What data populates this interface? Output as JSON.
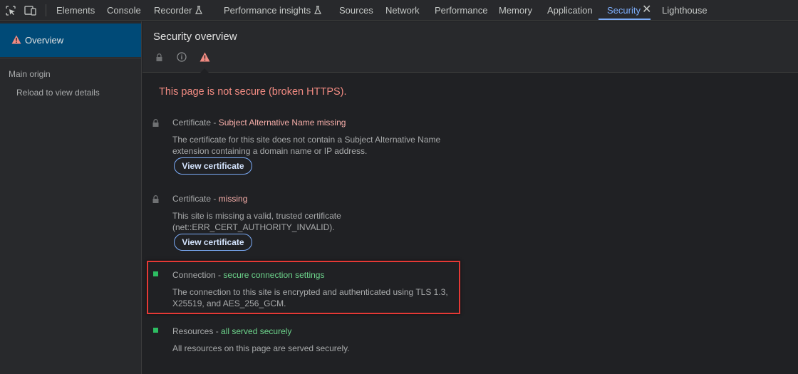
{
  "toolbar": {
    "tabs": [
      {
        "label": "Elements"
      },
      {
        "label": "Console"
      },
      {
        "label": "Recorder"
      },
      {
        "label": "Performance insights"
      },
      {
        "label": "Sources"
      },
      {
        "label": "Network"
      },
      {
        "label": "Performance"
      },
      {
        "label": "Memory"
      },
      {
        "label": "Application"
      },
      {
        "label": "Security",
        "active": true
      },
      {
        "label": "Lighthouse"
      }
    ],
    "icons": [
      "inspect-element-icon",
      "device-toolbar-icon",
      "flask-icon",
      "close-icon"
    ]
  },
  "sidebar": {
    "overview_label": "Overview",
    "main_origin_label": "Main origin",
    "reload_label": "Reload to view details"
  },
  "main": {
    "title": "Security overview",
    "summary": "This page is not secure (broken HTTPS).",
    "items": [
      {
        "category": "Certificate",
        "separator": " - ",
        "status": "Subject Alternative Name missing",
        "status_color": "#f6aea9",
        "icon": "lock-icon",
        "description": "The certificate for this site does not contain a Subject Alternative Name extension containing a domain name or IP address.",
        "button_label": "View certificate"
      },
      {
        "category": "Certificate",
        "separator": " - ",
        "status": "missing",
        "status_color": "#f6aea9",
        "icon": "lock-icon",
        "description": "This site is missing a valid, trusted certificate (net::ERR_CERT_AUTHORITY_INVALID).",
        "button_label": "View certificate"
      },
      {
        "category": "Connection",
        "separator": " - ",
        "status": "secure connection settings",
        "status_color": "#6dd58c",
        "icon": "secure-square-icon",
        "description": "The connection to this site is encrypted and authenticated using TLS 1.3, X25519, and AES_256_GCM."
      },
      {
        "category": "Resources",
        "separator": " - ",
        "status": "all served securely",
        "status_color": "#6dd58c",
        "icon": "secure-square-icon",
        "description": "All resources on this page are served securely."
      }
    ]
  },
  "colors": {
    "accent": "#7cacf8",
    "warning": "#f28b82",
    "secure": "#2dbd62",
    "highlight": "#e53935"
  }
}
